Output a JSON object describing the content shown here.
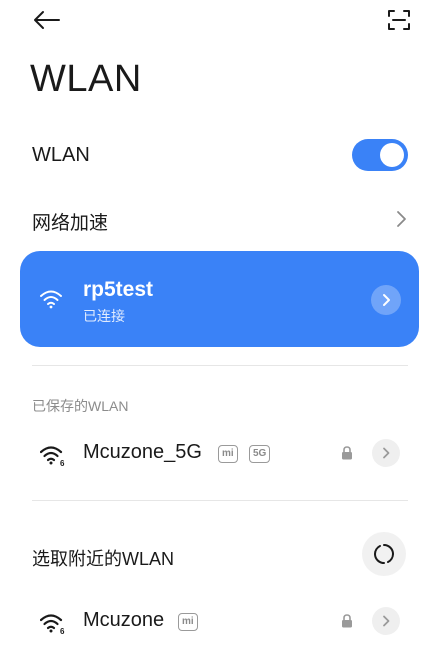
{
  "header": {
    "title": "WLAN",
    "back_icon": "arrow-left-icon",
    "scan_icon": "scan-icon"
  },
  "wlan": {
    "label": "WLAN",
    "enabled": true
  },
  "acceleration": {
    "label": "网络加速"
  },
  "connected": {
    "ssid": "rp5test",
    "status": "已连接"
  },
  "saved": {
    "header": "已保存的WLAN",
    "networks": [
      {
        "ssid": "Mcuzone_5G",
        "tags": [
          "mi",
          "5G"
        ],
        "wifi_badge": "6",
        "locked": true
      }
    ]
  },
  "nearby": {
    "header": "选取附近的WLAN",
    "networks": [
      {
        "ssid": "Mcuzone",
        "tags": [
          "mi"
        ],
        "wifi_badge": "6",
        "locked": true
      }
    ]
  },
  "colors": {
    "accent": "#3a82f7",
    "text": "#1a1a1a",
    "subtle": "#8c8c8c"
  }
}
